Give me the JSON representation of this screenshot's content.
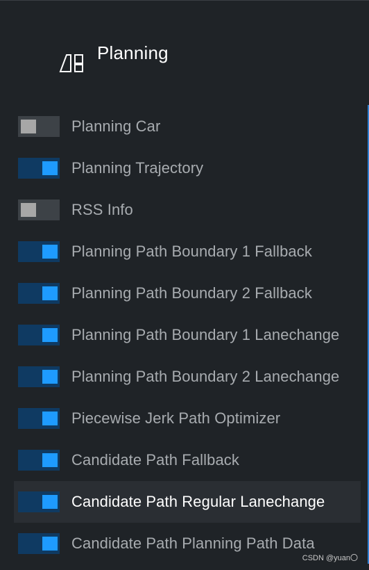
{
  "header": {
    "icon": "layers-icon",
    "title": "Planning"
  },
  "items": [
    {
      "label": "Planning Car",
      "enabled": false
    },
    {
      "label": "Planning Trajectory",
      "enabled": true
    },
    {
      "label": "RSS Info",
      "enabled": false
    },
    {
      "label": "Planning Path Boundary 1 Fallback",
      "enabled": true
    },
    {
      "label": "Planning Path Boundary 2 Fallback",
      "enabled": true
    },
    {
      "label": "Planning Path Boundary 1 Lanechange",
      "enabled": true
    },
    {
      "label": "Planning Path Boundary 2 Lanechange",
      "enabled": true
    },
    {
      "label": "Piecewise Jerk Path Optimizer",
      "enabled": true
    },
    {
      "label": "Candidate Path Fallback",
      "enabled": true
    },
    {
      "label": "Candidate Path Regular Lanechange",
      "enabled": true,
      "selected": true
    },
    {
      "label": "Candidate Path Planning Path Data",
      "enabled": true
    }
  ],
  "watermark": "CSDN @yuan〇",
  "colors": {
    "background": "#1f2327",
    "toggle_on_track": "#0f3a62",
    "toggle_on_knob": "#1e9bff",
    "toggle_off_track": "#3d4247",
    "toggle_off_knob": "#a7a7a7",
    "label_text": "#a8acb0",
    "selected_text": "#ffffff"
  }
}
